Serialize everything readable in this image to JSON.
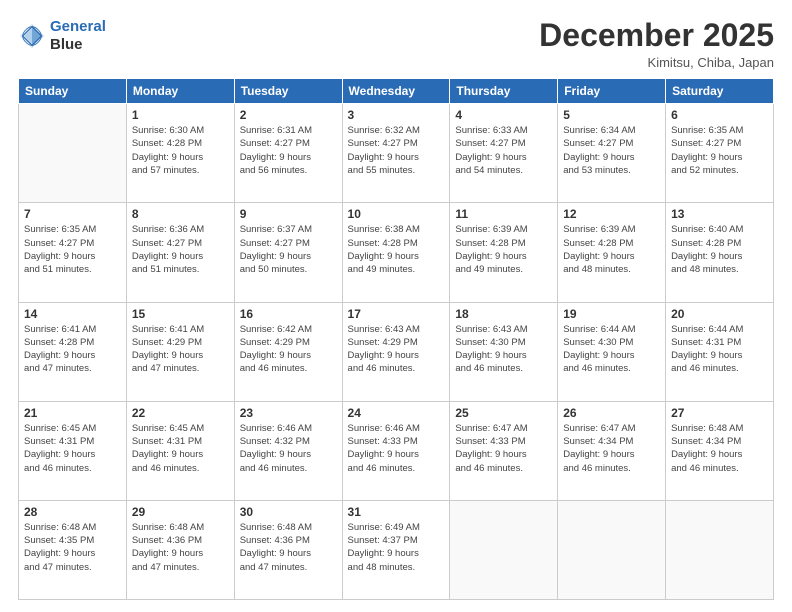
{
  "logo": {
    "line1": "General",
    "line2": "Blue"
  },
  "title": "December 2025",
  "location": "Kimitsu, Chiba, Japan",
  "headers": [
    "Sunday",
    "Monday",
    "Tuesday",
    "Wednesday",
    "Thursday",
    "Friday",
    "Saturday"
  ],
  "weeks": [
    [
      {
        "day": "",
        "sunrise": "",
        "sunset": "",
        "daylight": ""
      },
      {
        "day": "1",
        "sunrise": "Sunrise: 6:30 AM",
        "sunset": "Sunset: 4:28 PM",
        "daylight": "Daylight: 9 hours and 57 minutes."
      },
      {
        "day": "2",
        "sunrise": "Sunrise: 6:31 AM",
        "sunset": "Sunset: 4:27 PM",
        "daylight": "Daylight: 9 hours and 56 minutes."
      },
      {
        "day": "3",
        "sunrise": "Sunrise: 6:32 AM",
        "sunset": "Sunset: 4:27 PM",
        "daylight": "Daylight: 9 hours and 55 minutes."
      },
      {
        "day": "4",
        "sunrise": "Sunrise: 6:33 AM",
        "sunset": "Sunset: 4:27 PM",
        "daylight": "Daylight: 9 hours and 54 minutes."
      },
      {
        "day": "5",
        "sunrise": "Sunrise: 6:34 AM",
        "sunset": "Sunset: 4:27 PM",
        "daylight": "Daylight: 9 hours and 53 minutes."
      },
      {
        "day": "6",
        "sunrise": "Sunrise: 6:35 AM",
        "sunset": "Sunset: 4:27 PM",
        "daylight": "Daylight: 9 hours and 52 minutes."
      }
    ],
    [
      {
        "day": "7",
        "sunrise": "Sunrise: 6:35 AM",
        "sunset": "Sunset: 4:27 PM",
        "daylight": "Daylight: 9 hours and 51 minutes."
      },
      {
        "day": "8",
        "sunrise": "Sunrise: 6:36 AM",
        "sunset": "Sunset: 4:27 PM",
        "daylight": "Daylight: 9 hours and 51 minutes."
      },
      {
        "day": "9",
        "sunrise": "Sunrise: 6:37 AM",
        "sunset": "Sunset: 4:27 PM",
        "daylight": "Daylight: 9 hours and 50 minutes."
      },
      {
        "day": "10",
        "sunrise": "Sunrise: 6:38 AM",
        "sunset": "Sunset: 4:28 PM",
        "daylight": "Daylight: 9 hours and 49 minutes."
      },
      {
        "day": "11",
        "sunrise": "Sunrise: 6:39 AM",
        "sunset": "Sunset: 4:28 PM",
        "daylight": "Daylight: 9 hours and 49 minutes."
      },
      {
        "day": "12",
        "sunrise": "Sunrise: 6:39 AM",
        "sunset": "Sunset: 4:28 PM",
        "daylight": "Daylight: 9 hours and 48 minutes."
      },
      {
        "day": "13",
        "sunrise": "Sunrise: 6:40 AM",
        "sunset": "Sunset: 4:28 PM",
        "daylight": "Daylight: 9 hours and 48 minutes."
      }
    ],
    [
      {
        "day": "14",
        "sunrise": "Sunrise: 6:41 AM",
        "sunset": "Sunset: 4:28 PM",
        "daylight": "Daylight: 9 hours and 47 minutes."
      },
      {
        "day": "15",
        "sunrise": "Sunrise: 6:41 AM",
        "sunset": "Sunset: 4:29 PM",
        "daylight": "Daylight: 9 hours and 47 minutes."
      },
      {
        "day": "16",
        "sunrise": "Sunrise: 6:42 AM",
        "sunset": "Sunset: 4:29 PM",
        "daylight": "Daylight: 9 hours and 46 minutes."
      },
      {
        "day": "17",
        "sunrise": "Sunrise: 6:43 AM",
        "sunset": "Sunset: 4:29 PM",
        "daylight": "Daylight: 9 hours and 46 minutes."
      },
      {
        "day": "18",
        "sunrise": "Sunrise: 6:43 AM",
        "sunset": "Sunset: 4:30 PM",
        "daylight": "Daylight: 9 hours and 46 minutes."
      },
      {
        "day": "19",
        "sunrise": "Sunrise: 6:44 AM",
        "sunset": "Sunset: 4:30 PM",
        "daylight": "Daylight: 9 hours and 46 minutes."
      },
      {
        "day": "20",
        "sunrise": "Sunrise: 6:44 AM",
        "sunset": "Sunset: 4:31 PM",
        "daylight": "Daylight: 9 hours and 46 minutes."
      }
    ],
    [
      {
        "day": "21",
        "sunrise": "Sunrise: 6:45 AM",
        "sunset": "Sunset: 4:31 PM",
        "daylight": "Daylight: 9 hours and 46 minutes."
      },
      {
        "day": "22",
        "sunrise": "Sunrise: 6:45 AM",
        "sunset": "Sunset: 4:31 PM",
        "daylight": "Daylight: 9 hours and 46 minutes."
      },
      {
        "day": "23",
        "sunrise": "Sunrise: 6:46 AM",
        "sunset": "Sunset: 4:32 PM",
        "daylight": "Daylight: 9 hours and 46 minutes."
      },
      {
        "day": "24",
        "sunrise": "Sunrise: 6:46 AM",
        "sunset": "Sunset: 4:33 PM",
        "daylight": "Daylight: 9 hours and 46 minutes."
      },
      {
        "day": "25",
        "sunrise": "Sunrise: 6:47 AM",
        "sunset": "Sunset: 4:33 PM",
        "daylight": "Daylight: 9 hours and 46 minutes."
      },
      {
        "day": "26",
        "sunrise": "Sunrise: 6:47 AM",
        "sunset": "Sunset: 4:34 PM",
        "daylight": "Daylight: 9 hours and 46 minutes."
      },
      {
        "day": "27",
        "sunrise": "Sunrise: 6:48 AM",
        "sunset": "Sunset: 4:34 PM",
        "daylight": "Daylight: 9 hours and 46 minutes."
      }
    ],
    [
      {
        "day": "28",
        "sunrise": "Sunrise: 6:48 AM",
        "sunset": "Sunset: 4:35 PM",
        "daylight": "Daylight: 9 hours and 47 minutes."
      },
      {
        "day": "29",
        "sunrise": "Sunrise: 6:48 AM",
        "sunset": "Sunset: 4:36 PM",
        "daylight": "Daylight: 9 hours and 47 minutes."
      },
      {
        "day": "30",
        "sunrise": "Sunrise: 6:48 AM",
        "sunset": "Sunset: 4:36 PM",
        "daylight": "Daylight: 9 hours and 47 minutes."
      },
      {
        "day": "31",
        "sunrise": "Sunrise: 6:49 AM",
        "sunset": "Sunset: 4:37 PM",
        "daylight": "Daylight: 9 hours and 48 minutes."
      },
      {
        "day": "",
        "sunrise": "",
        "sunset": "",
        "daylight": ""
      },
      {
        "day": "",
        "sunrise": "",
        "sunset": "",
        "daylight": ""
      },
      {
        "day": "",
        "sunrise": "",
        "sunset": "",
        "daylight": ""
      }
    ]
  ]
}
